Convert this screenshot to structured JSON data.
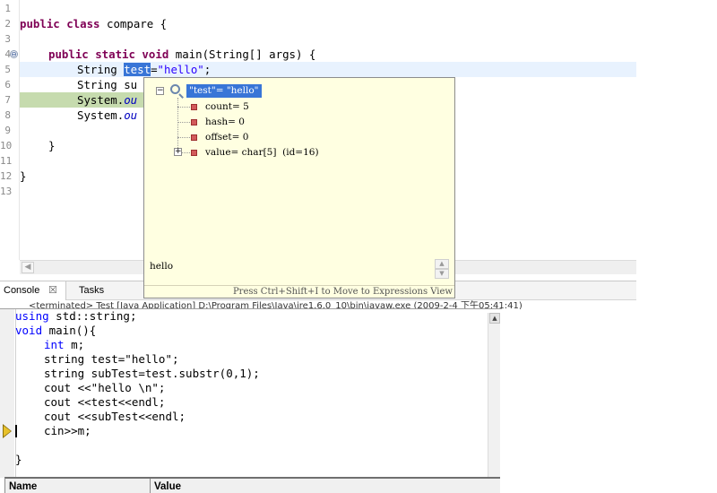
{
  "editor": {
    "line_numbers": [
      "1",
      "2",
      "3",
      "4",
      "5",
      "6",
      "7",
      "8",
      "9",
      "10",
      "11",
      "12",
      "13"
    ],
    "fold_marker": "⊖",
    "lines": {
      "l2_kw": "public class",
      "l2_rest": " compare {",
      "l4_kw": "public static void",
      "l4_rest": " main(String[] args) {",
      "l5_type": "String ",
      "l5_sel": "test",
      "l5_eq": "=",
      "l5_str": "\"hello\"",
      "l5_end": ";",
      "l6_text": "String su",
      "l7_sys": "System.",
      "l7_ou": "ou",
      "l8_sys": "System.",
      "l8_ou": "ou",
      "l10_text": "}",
      "l12_text": "}"
    },
    "scroll_left": "◀"
  },
  "hover": {
    "root_label": "\"test\"= \"hello\"",
    "root_expander": "−",
    "fields": [
      {
        "label": "count= 5"
      },
      {
        "label": "hash= 0"
      },
      {
        "label": "offset= 0"
      },
      {
        "label": "value= char[5]  (id=16)"
      }
    ],
    "value_expander": "+",
    "detail_text": "hello",
    "footer": "Press Ctrl+Shift+I to Move to Expressions View"
  },
  "console": {
    "tab_console": "Console",
    "close_glyph": "☒",
    "tab_tasks": "Tasks",
    "status_text": "<terminated> Test [Java Application] D:\\Program Files\\Java\\jre1.6.0_10\\bin\\javaw.exe (2009-2-4 下午05:41:41)"
  },
  "cpp": {
    "lines": {
      "c1_kw": "using",
      "c1_rest": " std::string;",
      "c2_kw": "void",
      "c2_rest": " main(){",
      "c3_kw": "int",
      "c3_rest": " m;",
      "c4": "string test=\"hello\";",
      "c5": "string subTest=test.substr(0,1);",
      "c6": "cout <<\"hello \\n\";",
      "c7": "cout <<test<<endl;",
      "c8": "cout <<subTest<<endl;",
      "c9": "cin>>m;",
      "c11": "}"
    },
    "scroll_up": "▲"
  },
  "watch": {
    "col_name": "Name",
    "col_value": "Value"
  },
  "colors": {
    "keyword_java": "#7f0055",
    "string_java": "#2a00ff",
    "field_italic": "#0000c0",
    "selection": "#3875d7",
    "hover_bg": "#ffffe1",
    "keyword_cpp": "#0000ff",
    "exec_arrow": "#e8c12a"
  }
}
